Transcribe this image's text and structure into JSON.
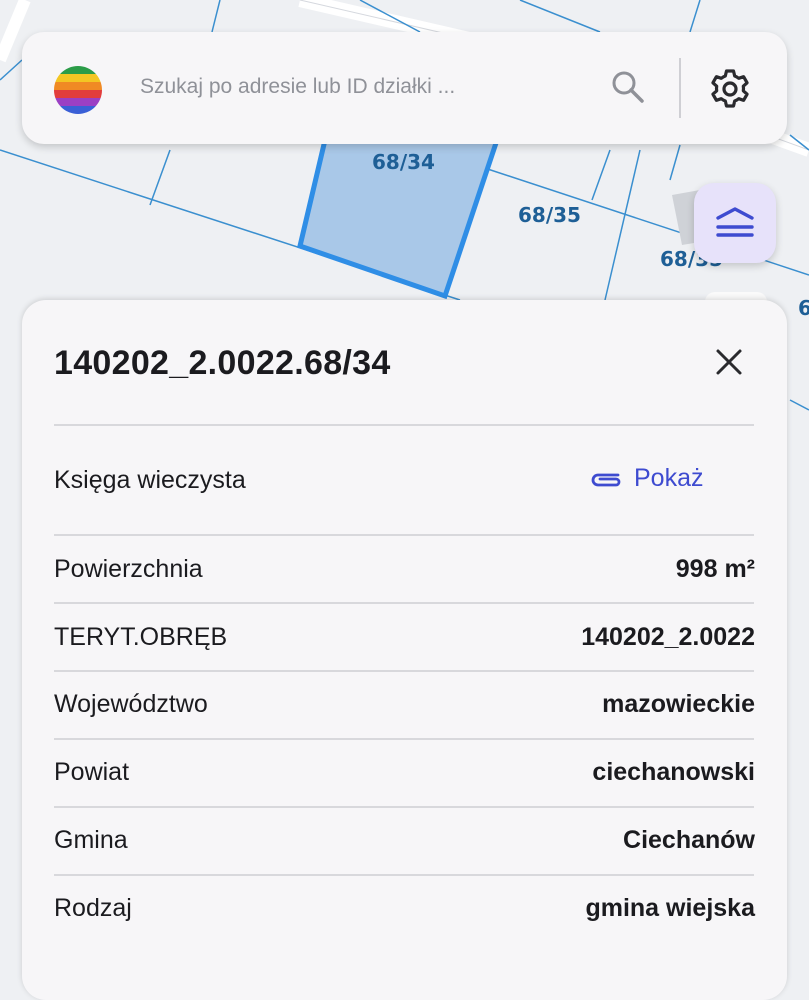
{
  "map": {
    "parcel_labels": [
      "68/34",
      "68/35",
      "68/35",
      "6"
    ]
  },
  "search": {
    "placeholder": "Szukaj po adresie lub ID działki ..."
  },
  "colors": {
    "accent": "#3e4bd0",
    "parcel_highlight": "#2f8ee6",
    "layers_button_bg": "#e7e2fa"
  },
  "icons": {
    "logo": "striped-globe-logo",
    "search": "search-icon",
    "settings": "gear-icon",
    "layers": "layers-icon",
    "close": "close-icon",
    "attachment": "paperclip-icon"
  },
  "panel": {
    "title": "140202_2.0022.68/34",
    "land_registry_label": "Księga wieczysta",
    "land_registry_link": "Pokaż",
    "rows": [
      {
        "label": "Powierzchnia",
        "value": "998 m²"
      },
      {
        "label": "TERYT.OBRĘB",
        "value": "140202_2.0022"
      },
      {
        "label": "Województwo",
        "value": "mazowieckie"
      },
      {
        "label": "Powiat",
        "value": "ciechanowski"
      },
      {
        "label": "Gmina",
        "value": "Ciechanów"
      },
      {
        "label": "Rodzaj",
        "value": "gmina wiejska"
      }
    ]
  }
}
